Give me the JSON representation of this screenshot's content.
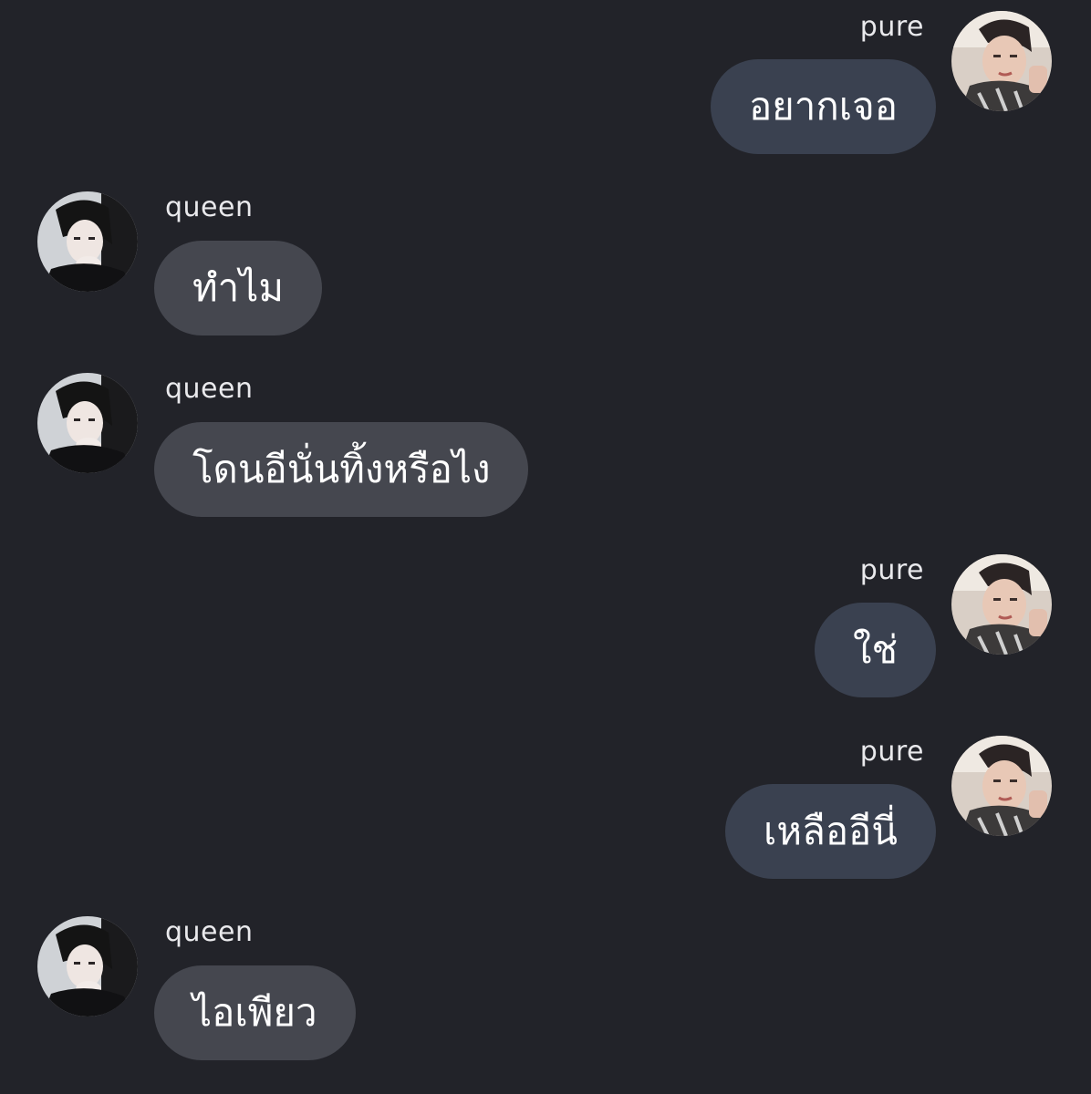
{
  "conversation": {
    "messages": [
      {
        "sender": "pure",
        "text": "อยากเจอ"
      },
      {
        "sender": "queen",
        "text": "ทำไม"
      },
      {
        "sender": "queen",
        "text": "โดนอีนั่นทิ้งหรือไง"
      },
      {
        "sender": "pure",
        "text": "ใช่"
      },
      {
        "sender": "pure",
        "text": "เหลืออีนี่"
      },
      {
        "sender": "queen",
        "text": "ไอเพียว"
      }
    ]
  },
  "colors": {
    "background": "#222329",
    "outgoing_bubble": "#3a4150",
    "incoming_bubble": "#45474f",
    "text": "#ffffff"
  }
}
